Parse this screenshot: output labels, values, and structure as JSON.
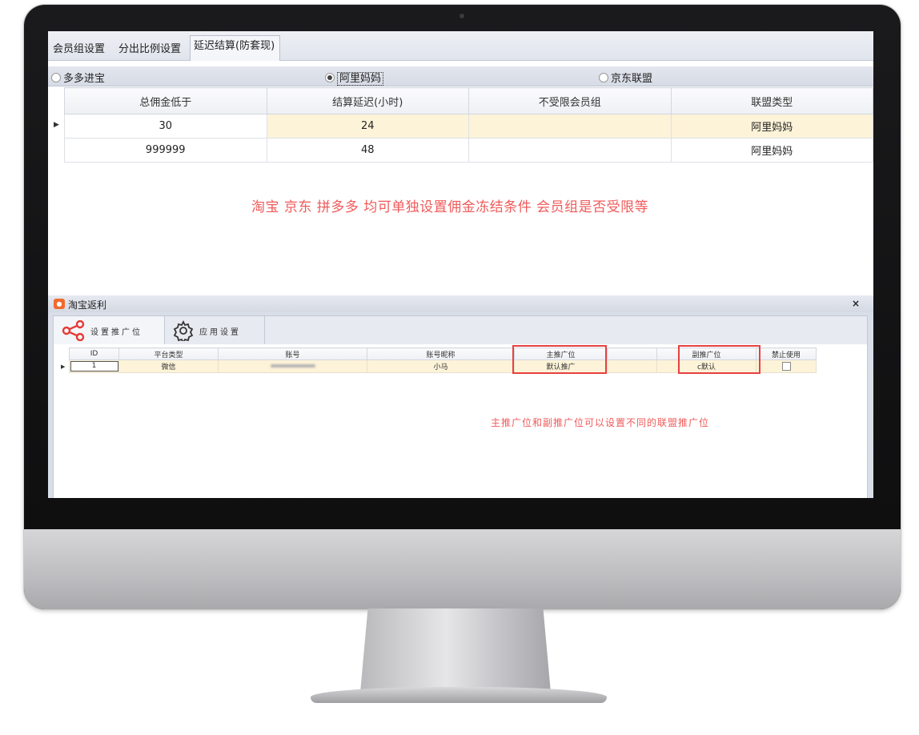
{
  "top_tabs": [
    "会员组设置",
    "分出比例设置",
    "延迟结算(防套现)"
  ],
  "platform_options": [
    "多多进宝",
    "阿里妈妈",
    "京东联盟"
  ],
  "selected_platform": "阿里妈妈",
  "delay_grid": {
    "columns": [
      "总佣金低于",
      "结算延迟(小时)",
      "不受限会员组",
      "联盟类型"
    ],
    "rows": [
      [
        "30",
        "24",
        "",
        "阿里妈妈"
      ],
      [
        "999999",
        "48",
        "",
        "阿里妈妈"
      ]
    ]
  },
  "note_upper": "淘宝  京东  拼多多  均可单独设置佣金冻结条件  会员组是否受限等",
  "sub_window": {
    "title": "淘宝返利",
    "close": "×",
    "tabs": [
      "设置推广位",
      "应用设置"
    ],
    "columns": [
      "ID",
      "平台类型",
      "账号",
      "账号昵称",
      "主推广位",
      "",
      "副推广位",
      "禁止使用"
    ],
    "row": {
      "id": "1",
      "platform": "微信",
      "nickname": "小马",
      "main_position": "默认推广",
      "sub_position": "c默认"
    },
    "note": "主推广位和副推广位可以设置不同的联盟推广位"
  },
  "colors": {
    "annotation": "#f05a5a",
    "highlight_box": "#e84040",
    "row_highlight": "#fdf3d8"
  }
}
